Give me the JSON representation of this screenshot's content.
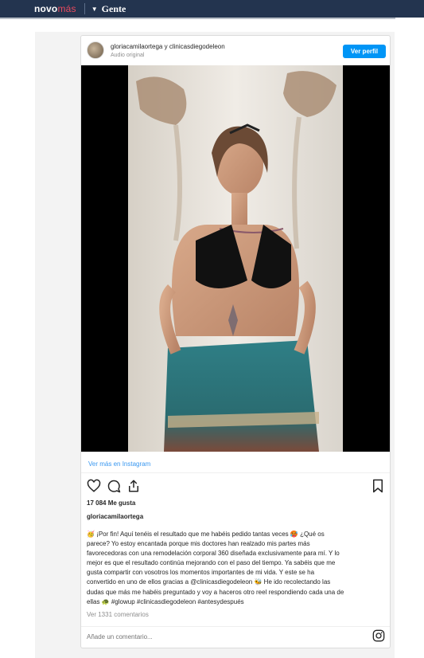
{
  "site": {
    "logo_main": "novo",
    "logo_accent": "más",
    "section": "Gente"
  },
  "post": {
    "author": "gloriacamilaortega",
    "connector": "y",
    "coauthor": "clinicasdiegodeleon",
    "audio": "Audio original",
    "profile_button": "Ver perfil",
    "more_link": "Ver más en Instagram",
    "likes": "17 084 Me gusta",
    "caption_user": "gloriacamilaortega",
    "caption_lines": [
      "🥳 ¡Por fin! Aquí tenéis el resultado que me habéis pedido tantas veces 🥵 ¿Qué os",
      "parece? Yo estoy encantada porque mis doctores han realzado mis partes más",
      "favorecedoras con una remodelación corporal 360 diseñada exclusivamente para mí. Y lo",
      "mejor es que el resultado continúa mejorando con el paso del tiempo. Ya sabéis que me",
      "gusta compartir con vosotros los momentos importantes de mi vida. Y este se ha",
      "convertido en uno de ellos gracias a @clinicasdiegodeleon 🐝 He ido recolectando las",
      "dudas que más me habéis preguntado y voy a haceros otro reel respondiendo cada una de",
      "ellas 🐢 #glowup #clinicasdiegodeleon #antesydespués"
    ],
    "comments": "Ver 1331 comentarios",
    "comment_placeholder": "Añade un comentario..."
  },
  "icons": {
    "like": "heart-icon",
    "comment": "comment-icon",
    "share": "share-icon",
    "save": "bookmark-icon",
    "instagram": "instagram-icon",
    "section_caret": "caret-down-icon"
  },
  "colors": {
    "topbar": "#23344f",
    "logo_accent": "#e84a5f",
    "button": "#0095f6",
    "link": "#3897f0"
  }
}
